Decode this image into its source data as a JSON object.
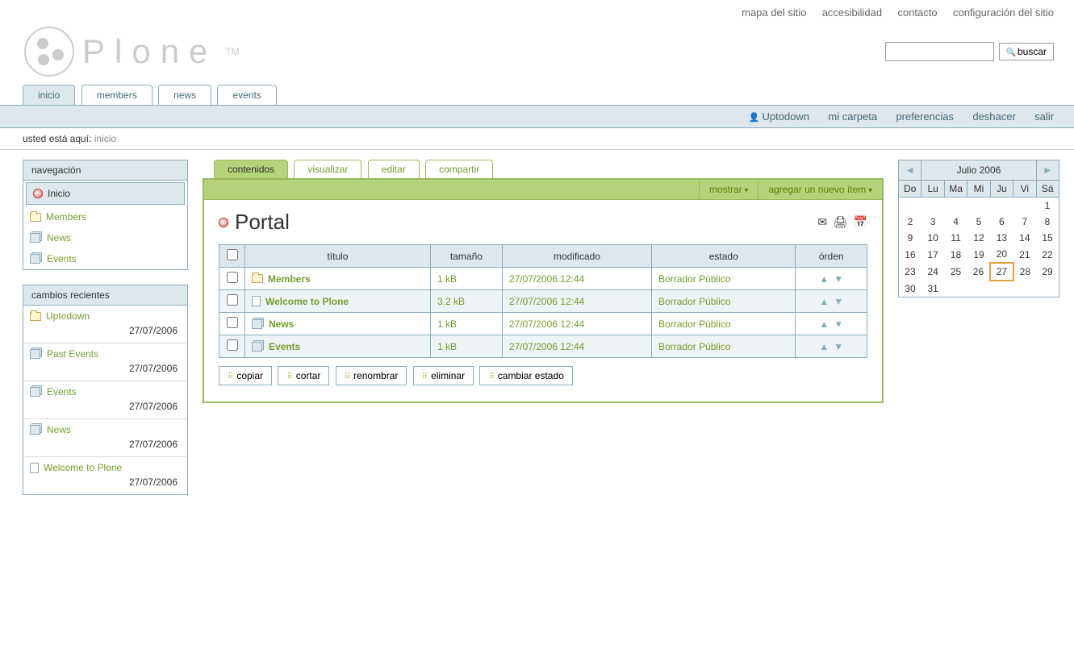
{
  "siteActions": {
    "sitemap": "mapa del sitio",
    "accessibility": "accesibilidad",
    "contact": "contacto",
    "siteSetup": "configuración del sitio"
  },
  "logo": {
    "text": "Plone",
    "tm": "TM"
  },
  "search": {
    "buttonLabel": "buscar",
    "value": ""
  },
  "mainTabs": {
    "home": "inicio",
    "members": "members",
    "news": "news",
    "events": "events"
  },
  "personalBar": {
    "user": "Uptodown",
    "myFolder": "mi carpeta",
    "preferences": "preferencias",
    "undo": "deshacer",
    "logout": "salir"
  },
  "breadcrumb": {
    "prefix": "usted está aquí:",
    "location": "inicio"
  },
  "navPortlet": {
    "title": "navegación",
    "items": [
      {
        "label": "Inicio",
        "icon": "home",
        "selected": true
      },
      {
        "label": "Members",
        "icon": "folder"
      },
      {
        "label": "News",
        "icon": "multi"
      },
      {
        "label": "Events",
        "icon": "multi"
      }
    ]
  },
  "recentPortlet": {
    "title": "cambios recientes",
    "items": [
      {
        "label": "Uptodown",
        "icon": "folder",
        "date": "27/07/2006"
      },
      {
        "label": "Past Events",
        "icon": "multi",
        "date": "27/07/2006"
      },
      {
        "label": "Events",
        "icon": "multi",
        "date": "27/07/2006"
      },
      {
        "label": "News",
        "icon": "multi",
        "date": "27/07/2006"
      },
      {
        "label": "Welcome to Plone",
        "icon": "doc",
        "date": "27/07/2006"
      }
    ]
  },
  "contentTabs": {
    "contents": "contenidos",
    "view": "visualizar",
    "edit": "editar",
    "share": "compartir"
  },
  "actionBar": {
    "display": "mostrar",
    "addNew": "agregar un nuevo ítem"
  },
  "pageTitle": "Portal",
  "tableHeaders": {
    "title": "título",
    "size": "tamaño",
    "modified": "modificado",
    "state": "estado",
    "order": "órden"
  },
  "rows": [
    {
      "title": "Members",
      "icon": "folder",
      "size": "1 kB",
      "modified": "27/07/2006 12:44",
      "state": "Borrador Público"
    },
    {
      "title": "Welcome to Plone",
      "icon": "doc",
      "size": "3.2 kB",
      "modified": "27/07/2006 12:44",
      "state": "Borrador Público"
    },
    {
      "title": "News",
      "icon": "multi",
      "size": "1 kB",
      "modified": "27/07/2006 12:44",
      "state": "Borrador Público"
    },
    {
      "title": "Events",
      "icon": "multi",
      "size": "1 kB",
      "modified": "27/07/2006 12:44",
      "state": "Borrador Público"
    }
  ],
  "buttons": {
    "copy": "copiar",
    "cut": "cortar",
    "rename": "renombrar",
    "delete": "eliminar",
    "changeState": "cambiar estado"
  },
  "calendar": {
    "title": "Julio 2006",
    "weekdays": [
      "Do",
      "Lu",
      "Ma",
      "Mi",
      "Ju",
      "Vi",
      "Sá"
    ],
    "firstDayOffset": 6,
    "daysInMonth": 31,
    "today": 27
  }
}
